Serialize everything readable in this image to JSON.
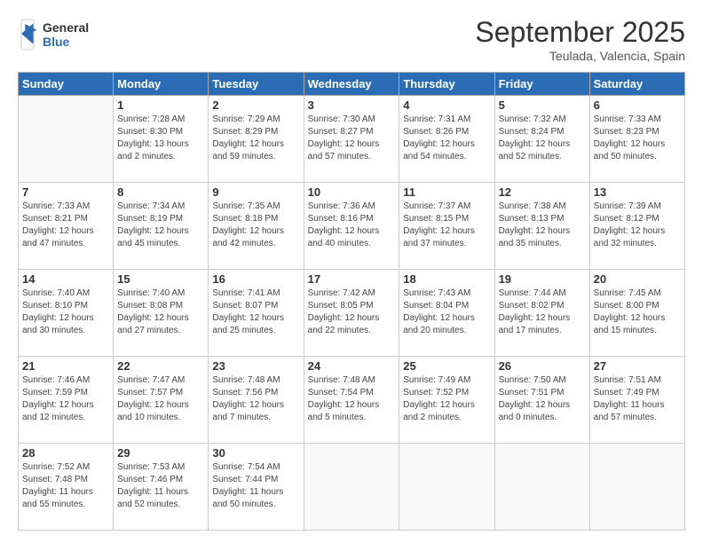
{
  "logo": {
    "general": "General",
    "blue": "Blue"
  },
  "header": {
    "month": "September 2025",
    "location": "Teulada, Valencia, Spain"
  },
  "days_of_week": [
    "Sunday",
    "Monday",
    "Tuesday",
    "Wednesday",
    "Thursday",
    "Friday",
    "Saturday"
  ],
  "weeks": [
    [
      {
        "day": "",
        "info": ""
      },
      {
        "day": "1",
        "info": "Sunrise: 7:28 AM\nSunset: 8:30 PM\nDaylight: 13 hours\nand 2 minutes."
      },
      {
        "day": "2",
        "info": "Sunrise: 7:29 AM\nSunset: 8:29 PM\nDaylight: 12 hours\nand 59 minutes."
      },
      {
        "day": "3",
        "info": "Sunrise: 7:30 AM\nSunset: 8:27 PM\nDaylight: 12 hours\nand 57 minutes."
      },
      {
        "day": "4",
        "info": "Sunrise: 7:31 AM\nSunset: 8:26 PM\nDaylight: 12 hours\nand 54 minutes."
      },
      {
        "day": "5",
        "info": "Sunrise: 7:32 AM\nSunset: 8:24 PM\nDaylight: 12 hours\nand 52 minutes."
      },
      {
        "day": "6",
        "info": "Sunrise: 7:33 AM\nSunset: 8:23 PM\nDaylight: 12 hours\nand 50 minutes."
      }
    ],
    [
      {
        "day": "7",
        "info": "Sunrise: 7:33 AM\nSunset: 8:21 PM\nDaylight: 12 hours\nand 47 minutes."
      },
      {
        "day": "8",
        "info": "Sunrise: 7:34 AM\nSunset: 8:19 PM\nDaylight: 12 hours\nand 45 minutes."
      },
      {
        "day": "9",
        "info": "Sunrise: 7:35 AM\nSunset: 8:18 PM\nDaylight: 12 hours\nand 42 minutes."
      },
      {
        "day": "10",
        "info": "Sunrise: 7:36 AM\nSunset: 8:16 PM\nDaylight: 12 hours\nand 40 minutes."
      },
      {
        "day": "11",
        "info": "Sunrise: 7:37 AM\nSunset: 8:15 PM\nDaylight: 12 hours\nand 37 minutes."
      },
      {
        "day": "12",
        "info": "Sunrise: 7:38 AM\nSunset: 8:13 PM\nDaylight: 12 hours\nand 35 minutes."
      },
      {
        "day": "13",
        "info": "Sunrise: 7:39 AM\nSunset: 8:12 PM\nDaylight: 12 hours\nand 32 minutes."
      }
    ],
    [
      {
        "day": "14",
        "info": "Sunrise: 7:40 AM\nSunset: 8:10 PM\nDaylight: 12 hours\nand 30 minutes."
      },
      {
        "day": "15",
        "info": "Sunrise: 7:40 AM\nSunset: 8:08 PM\nDaylight: 12 hours\nand 27 minutes."
      },
      {
        "day": "16",
        "info": "Sunrise: 7:41 AM\nSunset: 8:07 PM\nDaylight: 12 hours\nand 25 minutes."
      },
      {
        "day": "17",
        "info": "Sunrise: 7:42 AM\nSunset: 8:05 PM\nDaylight: 12 hours\nand 22 minutes."
      },
      {
        "day": "18",
        "info": "Sunrise: 7:43 AM\nSunset: 8:04 PM\nDaylight: 12 hours\nand 20 minutes."
      },
      {
        "day": "19",
        "info": "Sunrise: 7:44 AM\nSunset: 8:02 PM\nDaylight: 12 hours\nand 17 minutes."
      },
      {
        "day": "20",
        "info": "Sunrise: 7:45 AM\nSunset: 8:00 PM\nDaylight: 12 hours\nand 15 minutes."
      }
    ],
    [
      {
        "day": "21",
        "info": "Sunrise: 7:46 AM\nSunset: 7:59 PM\nDaylight: 12 hours\nand 12 minutes."
      },
      {
        "day": "22",
        "info": "Sunrise: 7:47 AM\nSunset: 7:57 PM\nDaylight: 12 hours\nand 10 minutes."
      },
      {
        "day": "23",
        "info": "Sunrise: 7:48 AM\nSunset: 7:56 PM\nDaylight: 12 hours\nand 7 minutes."
      },
      {
        "day": "24",
        "info": "Sunrise: 7:48 AM\nSunset: 7:54 PM\nDaylight: 12 hours\nand 5 minutes."
      },
      {
        "day": "25",
        "info": "Sunrise: 7:49 AM\nSunset: 7:52 PM\nDaylight: 12 hours\nand 2 minutes."
      },
      {
        "day": "26",
        "info": "Sunrise: 7:50 AM\nSunset: 7:51 PM\nDaylight: 12 hours\nand 0 minutes."
      },
      {
        "day": "27",
        "info": "Sunrise: 7:51 AM\nSunset: 7:49 PM\nDaylight: 11 hours\nand 57 minutes."
      }
    ],
    [
      {
        "day": "28",
        "info": "Sunrise: 7:52 AM\nSunset: 7:48 PM\nDaylight: 11 hours\nand 55 minutes."
      },
      {
        "day": "29",
        "info": "Sunrise: 7:53 AM\nSunset: 7:46 PM\nDaylight: 11 hours\nand 52 minutes."
      },
      {
        "day": "30",
        "info": "Sunrise: 7:54 AM\nSunset: 7:44 PM\nDaylight: 11 hours\nand 50 minutes."
      },
      {
        "day": "",
        "info": ""
      },
      {
        "day": "",
        "info": ""
      },
      {
        "day": "",
        "info": ""
      },
      {
        "day": "",
        "info": ""
      }
    ]
  ]
}
